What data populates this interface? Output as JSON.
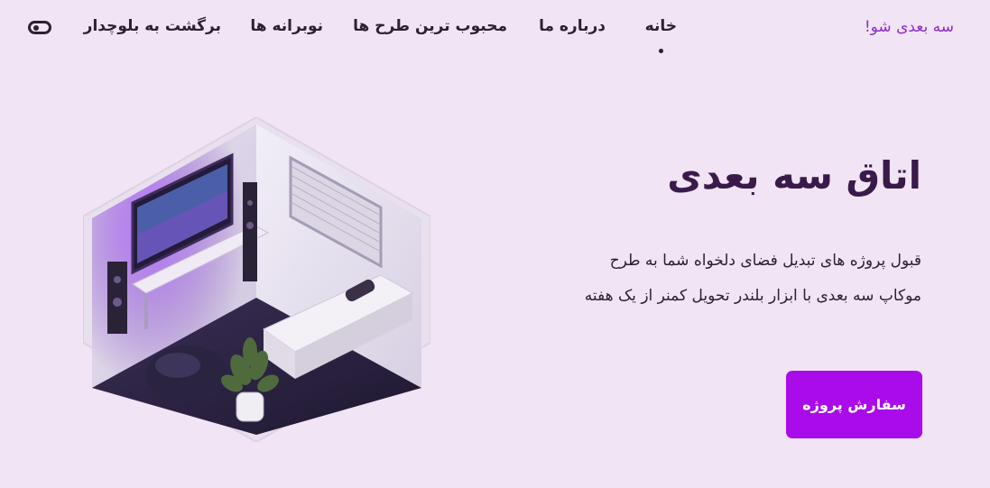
{
  "header": {
    "brand": "سه بعدی شو!",
    "nav": [
      {
        "label": "خانه",
        "active": true
      },
      {
        "label": "درباره ما",
        "active": false
      },
      {
        "label": "محبوب ترین طرح ها",
        "active": false
      },
      {
        "label": "نوبرانه ها",
        "active": false
      },
      {
        "label": "برگشت به بلوچدار",
        "active": false
      }
    ],
    "theme_toggle_icon": "toggle-icon"
  },
  "hero": {
    "title": "اتاق سه بعدی",
    "description": "قبول پروژه های تبدیل فضای دلخواه شما به طرح موکاپ سه بعدی با ابزار بلندر تحویل کمنر از یک هفته",
    "cta_label": "سفارش پروژه",
    "image_icon": "isometric-room-illustration"
  },
  "colors": {
    "background": "#f1e4f4",
    "accent": "#a90bea",
    "brand": "#8a2fc9",
    "text": "#2a2230"
  }
}
